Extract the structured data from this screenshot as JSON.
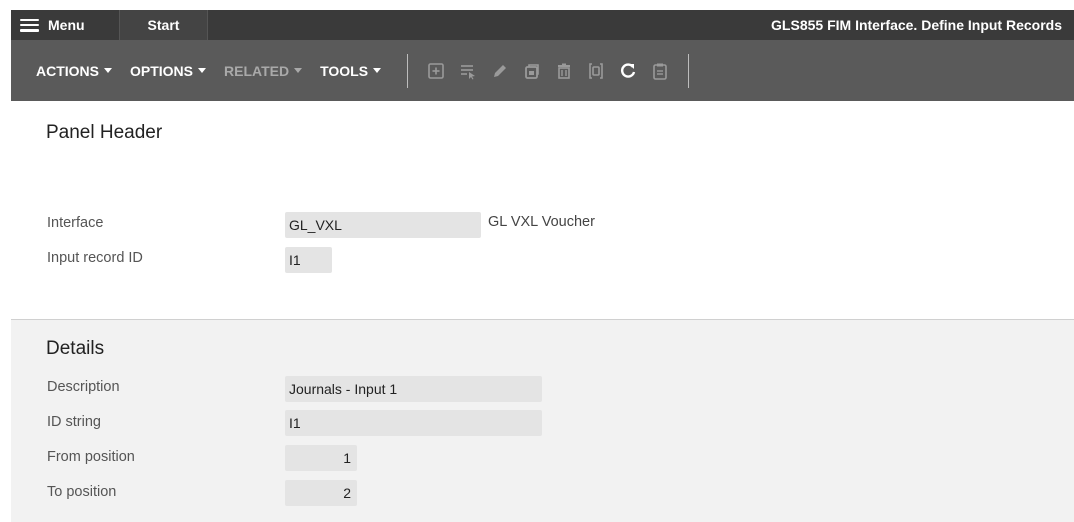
{
  "topbar": {
    "menu_label": "Menu",
    "start_label": "Start",
    "title": "GLS855 FIM Interface. Define Input Records"
  },
  "toolbar": {
    "actions_label": "ACTIONS",
    "options_label": "OPTIONS",
    "related_label": "RELATED",
    "tools_label": "TOOLS",
    "icons": [
      "add-icon",
      "filter-select-icon",
      "edit-icon",
      "copy-icon",
      "delete-icon",
      "display-icon",
      "refresh-icon",
      "clipboard-icon"
    ]
  },
  "panel_header": {
    "title": "Panel Header",
    "interface_label": "Interface",
    "interface_value": "GL_VXL",
    "interface_desc": "GL VXL Voucher",
    "input_record_label": "Input record ID",
    "input_record_value": "I1"
  },
  "details": {
    "title": "Details",
    "description_label": "Description",
    "description_value": "Journals - Input 1",
    "id_string_label": "ID string",
    "id_string_value": "I1",
    "from_position_label": "From position",
    "from_position_value": "1",
    "to_position_label": "To position",
    "to_position_value": "2"
  },
  "colors": {
    "topbar_bg": "#3a3a3a",
    "toolbar_bg": "#5a5a5a",
    "field_bg": "#e4e4e4",
    "details_bg": "#f2f2f2"
  }
}
